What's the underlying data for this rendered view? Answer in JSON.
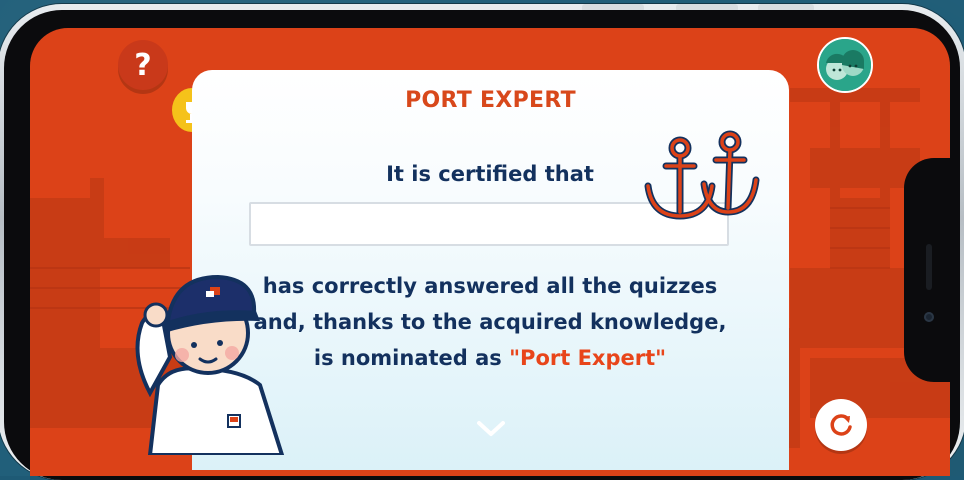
{
  "certificate": {
    "title": "PORT EXPERT",
    "certified_line": "It is certified that",
    "name_value": "",
    "body_line_1": "has correctly answered all the quizzes",
    "body_line_2": "and, thanks to the acquired knowledge,",
    "body_line_3_prefix": "is nominated as ",
    "body_line_3_highlight": "\"Port Expert\""
  },
  "controls": {
    "help_label": "?"
  },
  "icons": {
    "help": "question-mark-icon",
    "trophy": "trophy-icon",
    "avatar": "kids-avatar-icon",
    "refresh": "refresh-icon",
    "scroll": "chevron-down-icon",
    "anchors": "anchors-icon",
    "sailor": "sailor-mascot"
  },
  "colors": {
    "screen_background": "#dc4218",
    "title": "#d8481b",
    "text": "#13315e",
    "highlight": "#e8451a",
    "avatar": "#2aa58a",
    "trophy": "#f5c21a"
  }
}
